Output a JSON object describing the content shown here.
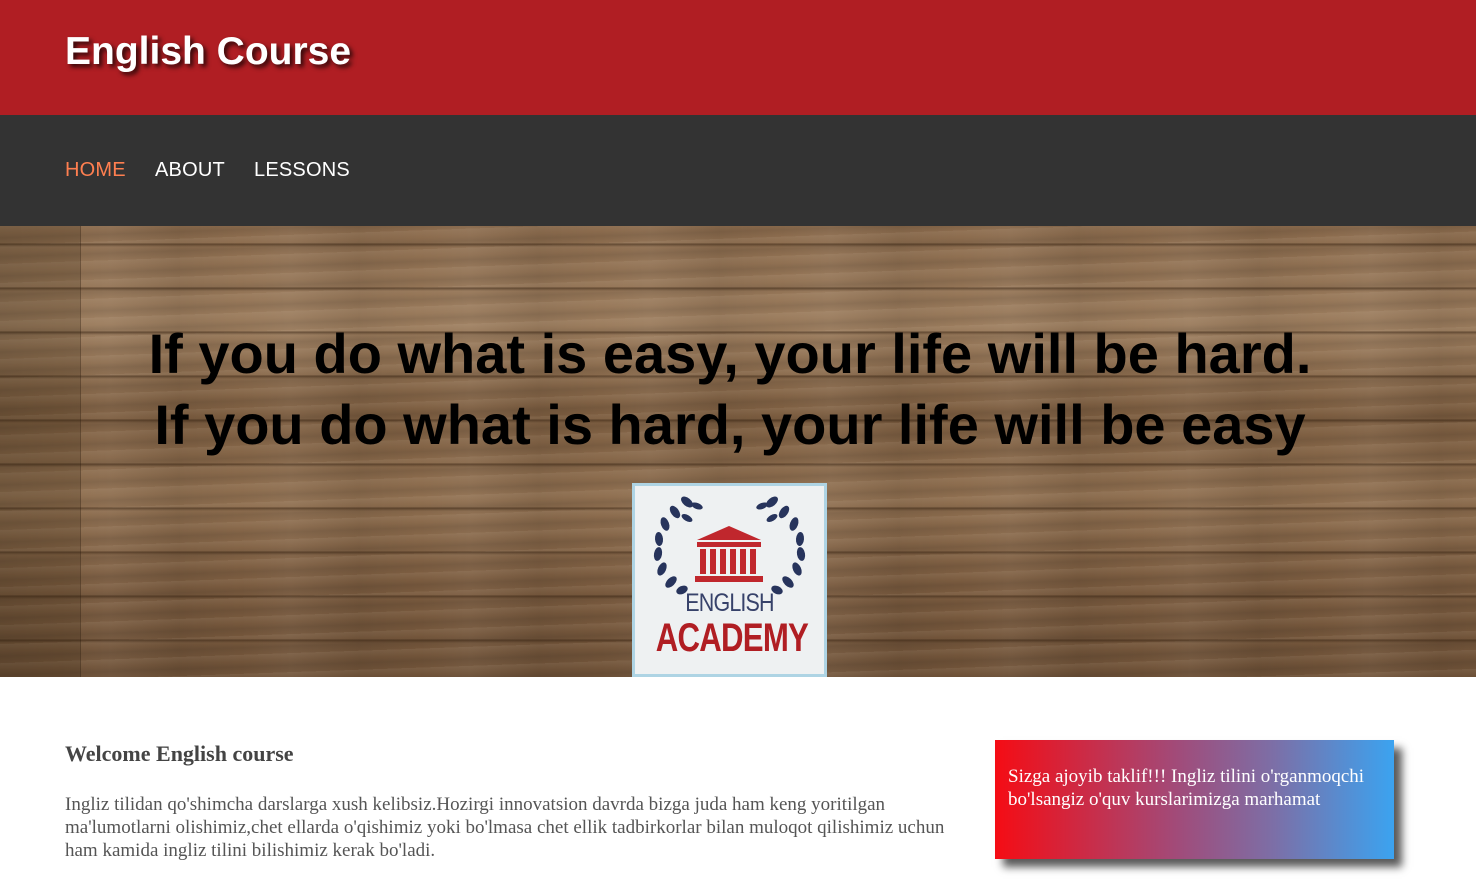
{
  "header": {
    "brand": "English Course",
    "brand_color": "#b01e23"
  },
  "nav": {
    "background": "#333333",
    "active_color": "#ff7f50",
    "items": [
      {
        "label": "HOME",
        "active": true
      },
      {
        "label": "ABOUT",
        "active": false
      },
      {
        "label": "LESSONS",
        "active": false
      }
    ]
  },
  "hero": {
    "quote_lines": [
      "If you do what is easy, your life will be hard.",
      "If you do what is hard, your life will be easy"
    ],
    "background": "wood-texture",
    "logo": {
      "icon": "academy-building-laurel-icon",
      "line1": "ENGLISH",
      "line2": "ACADEMY"
    }
  },
  "welcome": {
    "title": "Welcome English course",
    "body": "Ingliz tilidan qo'shimcha darslarga xush kelibsiz.Hozirgi innovatsion davrda bizga juda ham keng yoritilgan ma'lumotlarni olishimiz,chet ellarda o'qishimiz yoki bo'lmasa chet ellik tadbirkorlar bilan muloqot qilishimiz uchun ham kamida ingliz tilini bilishimiz kerak bo'ladi."
  },
  "promo": {
    "text": "Sizga ajoyib taklif!!! Ingliz tilini o'rganmoqchi bo'lsangiz o'quv kurslarimizga marhamat",
    "gradient": [
      "#f50c14",
      "#3ba3f0"
    ]
  }
}
